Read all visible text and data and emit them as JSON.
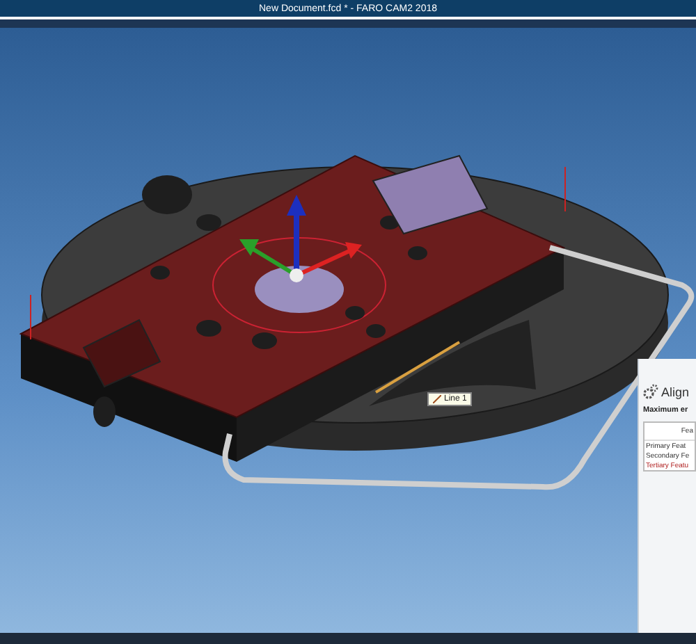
{
  "window": {
    "title": "New Document.fcd * - FARO CAM2 2018"
  },
  "viewport": {
    "feature_label": "Line 1"
  },
  "panel": {
    "title": "Align",
    "section": "Maximum er",
    "table": {
      "columns": [
        "Fea"
      ],
      "rows": [
        {
          "cells": [
            "Primary Feat"
          ],
          "selected": false
        },
        {
          "cells": [
            "Secondary Fe"
          ],
          "selected": false
        },
        {
          "cells": [
            "Tertiary Featu"
          ],
          "selected": true
        }
      ]
    }
  }
}
